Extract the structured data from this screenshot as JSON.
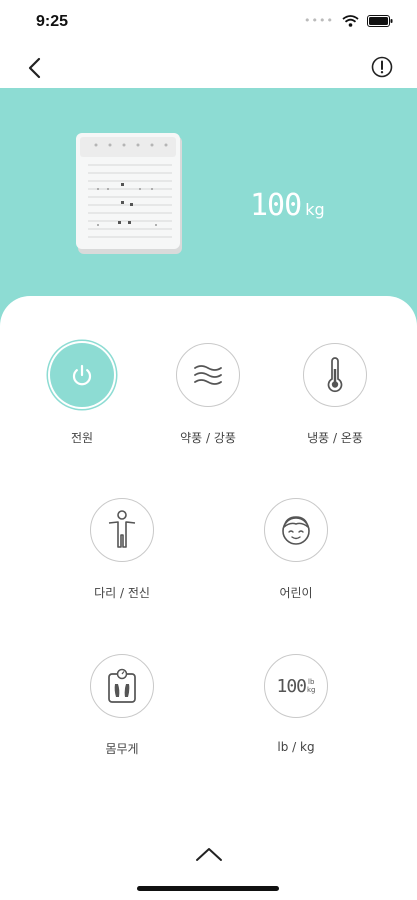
{
  "status_bar": {
    "time": "9:25"
  },
  "hero": {
    "weight_value": "100",
    "weight_unit": "kg"
  },
  "controls": [
    {
      "id": "power",
      "label": "전원",
      "icon": "power-icon",
      "active": true
    },
    {
      "id": "wind",
      "label": "약풍 / 강풍",
      "icon": "wind-waves-icon",
      "active": false
    },
    {
      "id": "temp",
      "label": "냉풍 / 온풍",
      "icon": "thermometer-icon",
      "active": false
    },
    {
      "id": "body",
      "label": "다리 / 전신",
      "icon": "person-icon",
      "active": false
    },
    {
      "id": "child",
      "label": "어린이",
      "icon": "child-face-icon",
      "active": false
    },
    {
      "id": "weight",
      "label": "몸무게",
      "icon": "scale-icon",
      "active": false
    },
    {
      "id": "unit",
      "label": "lb / kg",
      "icon": "unit-display-icon",
      "active": false
    }
  ],
  "unit_icon": {
    "digits": "100",
    "lb": "lb",
    "kg": "kg"
  },
  "colors": {
    "accent": "#8ddcd3",
    "circle_border": "#c9c9c9"
  }
}
